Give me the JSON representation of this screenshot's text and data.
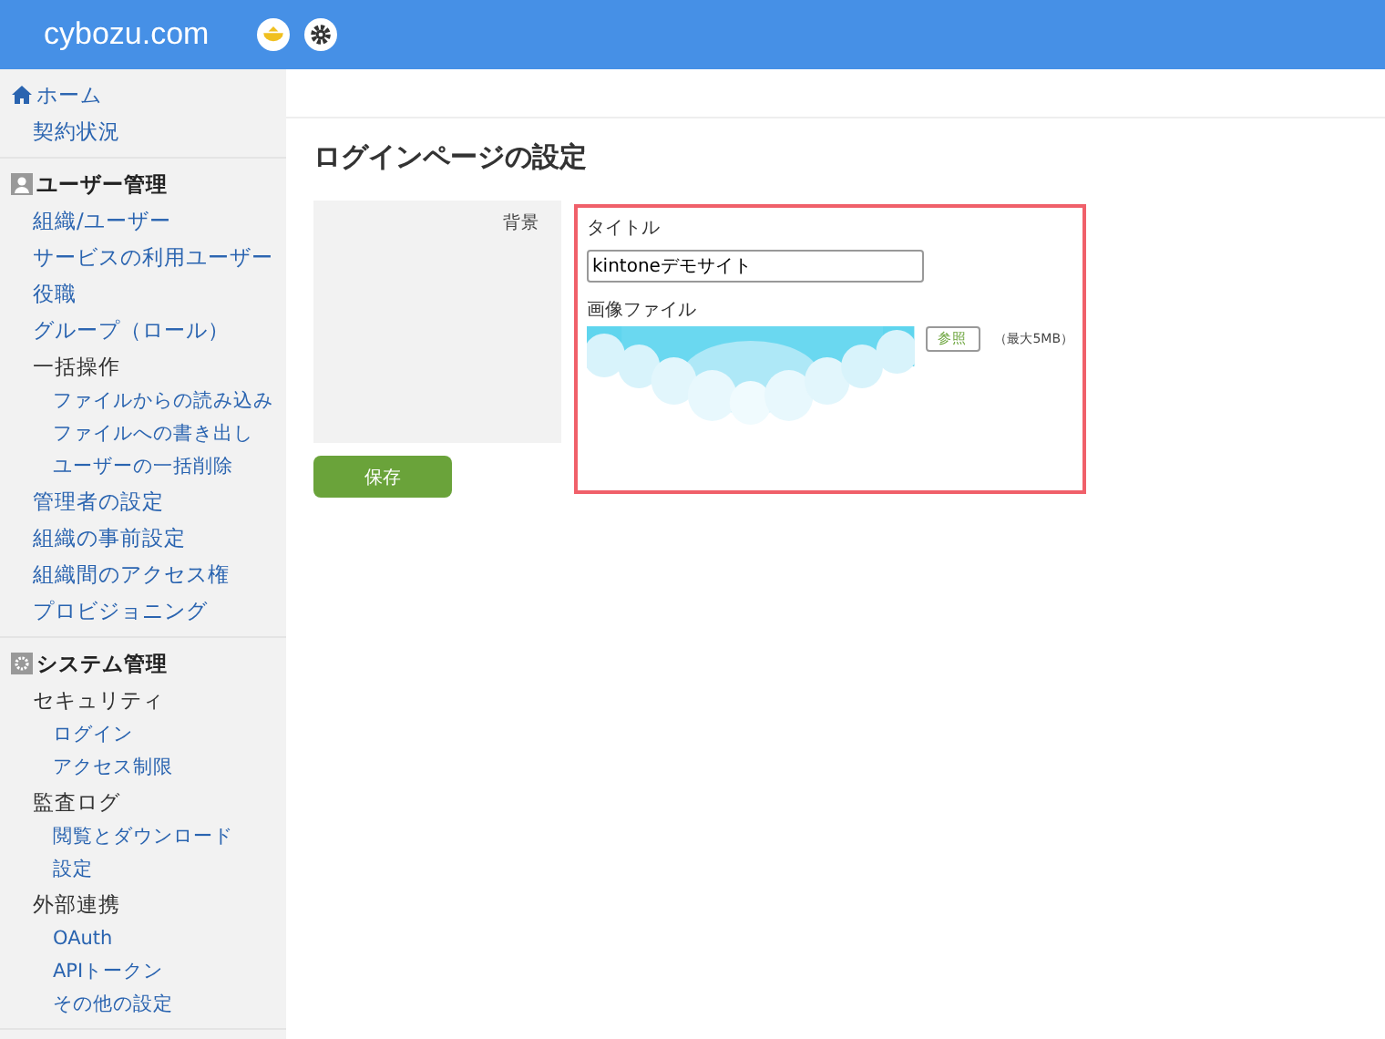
{
  "header": {
    "logo": "cybozu.com"
  },
  "sidebar": {
    "sections": [
      {
        "title": "ホーム",
        "kind": "link",
        "items": [
          {
            "label": "契約状況",
            "kind": "link"
          }
        ]
      },
      {
        "title": "ユーザー管理",
        "kind": "heading",
        "items": [
          {
            "label": "組織/ユーザー",
            "kind": "link"
          },
          {
            "label": "サービスの利用ユーザー",
            "kind": "link"
          },
          {
            "label": "役職",
            "kind": "link"
          },
          {
            "label": "グループ（ロール）",
            "kind": "link"
          },
          {
            "label": "一括操作",
            "kind": "group",
            "children": [
              {
                "label": "ファイルからの読み込み"
              },
              {
                "label": "ファイルへの書き出し"
              },
              {
                "label": "ユーザーの一括削除"
              }
            ]
          },
          {
            "label": "管理者の設定",
            "kind": "link"
          },
          {
            "label": "組織の事前設定",
            "kind": "link"
          },
          {
            "label": "組織間のアクセス権",
            "kind": "link"
          },
          {
            "label": "プロビジョニング",
            "kind": "link"
          }
        ]
      },
      {
        "title": "システム管理",
        "kind": "heading",
        "items": [
          {
            "label": "セキュリティ",
            "kind": "group",
            "children": [
              {
                "label": "ログイン"
              },
              {
                "label": "アクセス制限"
              }
            ]
          },
          {
            "label": "監査ログ",
            "kind": "group",
            "children": [
              {
                "label": "閲覧とダウンロード"
              },
              {
                "label": "設定"
              }
            ]
          },
          {
            "label": "外部連携",
            "kind": "group",
            "children": [
              {
                "label": "OAuth"
              },
              {
                "label": "APIトークン"
              },
              {
                "label": "その他の設定"
              }
            ]
          }
        ]
      }
    ]
  },
  "page": {
    "title": "ログインページの設定",
    "row_label": "背景",
    "title_label": "タイトル",
    "title_value": "kintoneデモサイト",
    "image_label": "画像ファイル",
    "browse_button": "参照",
    "size_note": "（最大5MB）",
    "save_button": "保存"
  }
}
